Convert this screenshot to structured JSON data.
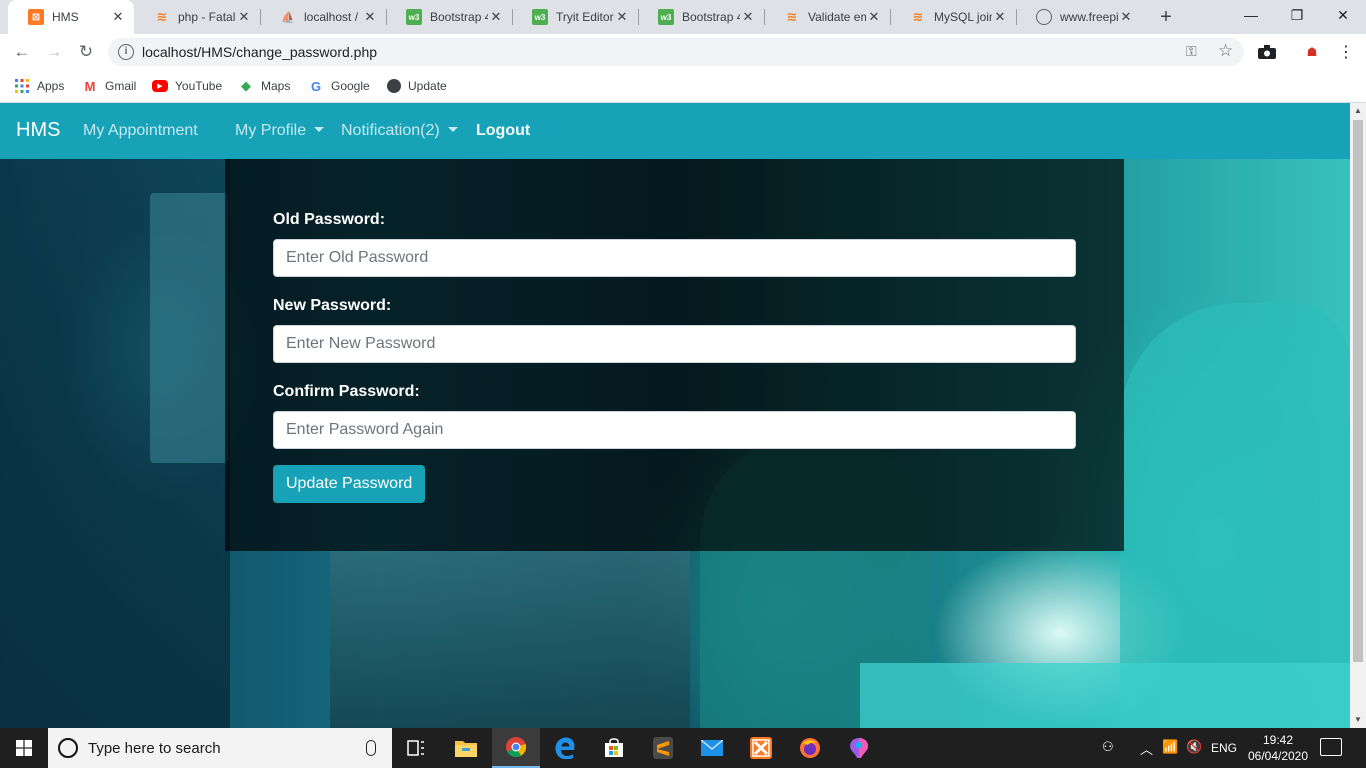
{
  "browser": {
    "tabs": [
      {
        "title": "HMS",
        "favicon": "xampp-icon",
        "color": "#fb7a24",
        "active": true
      },
      {
        "title": "php - Fatal",
        "favicon": "stackoverflow-icon",
        "color": "#f48024",
        "active": false
      },
      {
        "title": "localhost /",
        "favicon": "phpmyadmin-icon",
        "color": "#f89c0e",
        "active": false
      },
      {
        "title": "Bootstrap 4",
        "favicon": "w3schools-icon",
        "color": "#4caf50",
        "active": false
      },
      {
        "title": "Tryit Editor",
        "favicon": "w3schools-icon",
        "color": "#4caf50",
        "active": false
      },
      {
        "title": "Bootstrap 4",
        "favicon": "w3schools-icon",
        "color": "#4caf50",
        "active": false
      },
      {
        "title": "Validate em",
        "favicon": "stackoverflow-icon",
        "color": "#f48024",
        "active": false
      },
      {
        "title": "MySQL join",
        "favicon": "stackoverflow-icon",
        "color": "#f48024",
        "active": false
      },
      {
        "title": "www.freepi",
        "favicon": "globe-icon",
        "color": "#5f6368",
        "active": false
      }
    ],
    "url": "localhost/HMS/change_password.php",
    "bookmarks": [
      {
        "label": "Apps",
        "icon": "apps-grid-icon"
      },
      {
        "label": "Gmail",
        "icon": "gmail-icon"
      },
      {
        "label": "YouTube",
        "icon": "youtube-icon"
      },
      {
        "label": "Maps",
        "icon": "maps-icon"
      },
      {
        "label": "Google",
        "icon": "google-icon"
      },
      {
        "label": "Update",
        "icon": "globe-icon"
      }
    ]
  },
  "app": {
    "brand": "HMS",
    "nav": {
      "appointment": "My Appointment",
      "profile": "My Profile",
      "notification": "Notification(2)",
      "logout": "Logout"
    },
    "accent_color": "#17a2b8"
  },
  "form": {
    "old_label": "Old Password:",
    "old_placeholder": "Enter Old Password",
    "new_label": "New Password:",
    "new_placeholder": "Enter New Password",
    "confirm_label": "Confirm Password:",
    "confirm_placeholder": "Enter Password Again",
    "submit": "Update Password"
  },
  "taskbar": {
    "search_placeholder": "Type here to search",
    "language": "ENG",
    "time": "19:42",
    "date": "06/04/2020"
  }
}
